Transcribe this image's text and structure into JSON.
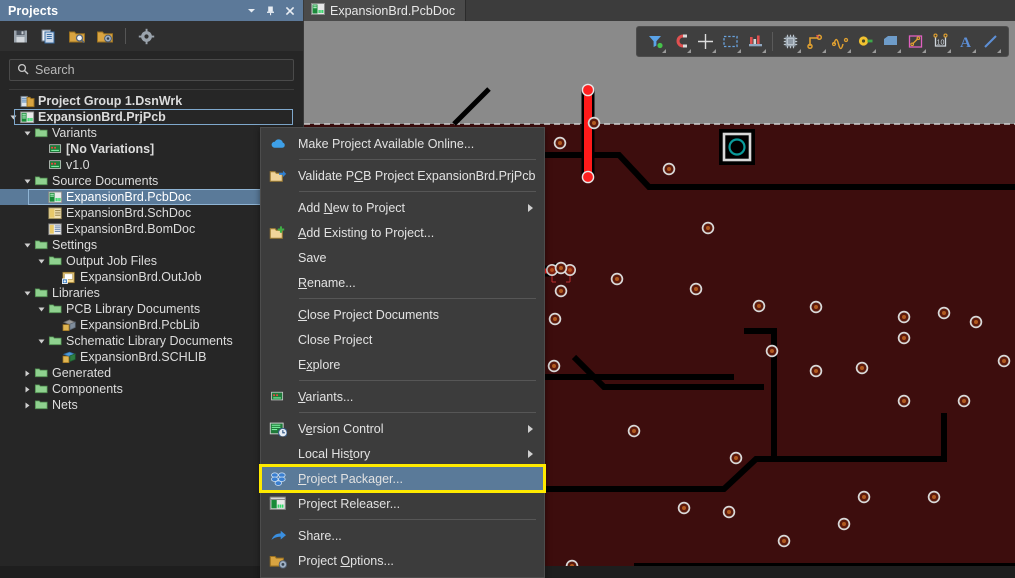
{
  "panel": {
    "title": "Projects",
    "window_buttons": [
      {
        "name": "dropdown-icon",
        "glyph": "▼"
      },
      {
        "name": "pin-icon",
        "glyph": "📌"
      },
      {
        "name": "close-icon",
        "glyph": "✕"
      }
    ],
    "toolbar": [
      {
        "name": "save-icon",
        "tip": "Save"
      },
      {
        "name": "copy-documents-icon",
        "tip": "Copy"
      },
      {
        "name": "folder-search-icon",
        "tip": "Browse"
      },
      {
        "name": "folder-settings-icon",
        "tip": "Project Settings"
      },
      {
        "name": "separator"
      },
      {
        "name": "gear-icon",
        "tip": "Options"
      }
    ],
    "search": {
      "placeholder": "Search",
      "value": ""
    },
    "tree": [
      {
        "label": "Project Group 1.DsnWrk",
        "depth": 0,
        "icon": "workspace-icon",
        "arrow": "none",
        "bold": true,
        "state": "normal"
      },
      {
        "label": "ExpansionBrd.PrjPcb",
        "depth": 0,
        "icon": "pcb-project-icon",
        "arrow": "down",
        "bold": true,
        "state": "outlined"
      },
      {
        "label": "Variants",
        "depth": 1,
        "icon": "folder-icon",
        "arrow": "down",
        "bold": false,
        "state": "normal"
      },
      {
        "label": "[No Variations]",
        "depth": 2,
        "icon": "variant-icon",
        "arrow": "none",
        "bold": true,
        "state": "normal"
      },
      {
        "label": "v1.0",
        "depth": 2,
        "icon": "variant-icon",
        "arrow": "none",
        "bold": false,
        "state": "normal"
      },
      {
        "label": "Source Documents",
        "depth": 1,
        "icon": "folder-icon",
        "arrow": "down",
        "bold": false,
        "state": "normal"
      },
      {
        "label": "ExpansionBrd.PcbDoc",
        "depth": 2,
        "icon": "pcbdoc-icon",
        "arrow": "none",
        "bold": false,
        "state": "selected"
      },
      {
        "label": "ExpansionBrd.SchDoc",
        "depth": 2,
        "icon": "schdoc-icon",
        "arrow": "none",
        "bold": false,
        "state": "normal"
      },
      {
        "label": "ExpansionBrd.BomDoc",
        "depth": 2,
        "icon": "bomdoc-icon",
        "arrow": "none",
        "bold": false,
        "state": "normal"
      },
      {
        "label": "Settings",
        "depth": 1,
        "icon": "folder-icon",
        "arrow": "down",
        "bold": false,
        "state": "normal"
      },
      {
        "label": "Output Job Files",
        "depth": 2,
        "icon": "folder-icon",
        "arrow": "down",
        "bold": false,
        "state": "normal"
      },
      {
        "label": "ExpansionBrd.OutJob",
        "depth": 3,
        "icon": "outjob-icon",
        "arrow": "none",
        "bold": false,
        "state": "normal"
      },
      {
        "label": "Libraries",
        "depth": 1,
        "icon": "folder-icon",
        "arrow": "down",
        "bold": false,
        "state": "normal"
      },
      {
        "label": "PCB Library Documents",
        "depth": 2,
        "icon": "folder-icon",
        "arrow": "down",
        "bold": false,
        "state": "normal"
      },
      {
        "label": "ExpansionBrd.PcbLib",
        "depth": 3,
        "icon": "pcblib-icon",
        "arrow": "none",
        "bold": false,
        "state": "normal"
      },
      {
        "label": "Schematic Library Documents",
        "depth": 2,
        "icon": "folder-icon",
        "arrow": "down",
        "bold": false,
        "state": "normal"
      },
      {
        "label": "ExpansionBrd.SCHLIB",
        "depth": 3,
        "icon": "schlib-icon",
        "arrow": "none",
        "bold": false,
        "state": "normal"
      },
      {
        "label": "Generated",
        "depth": 1,
        "icon": "folder-icon",
        "arrow": "right",
        "bold": false,
        "state": "normal"
      },
      {
        "label": "Components",
        "depth": 1,
        "icon": "folder-icon",
        "arrow": "right",
        "bold": false,
        "state": "normal"
      },
      {
        "label": "Nets",
        "depth": 1,
        "icon": "folder-icon",
        "arrow": "right",
        "bold": false,
        "state": "normal"
      }
    ]
  },
  "editor": {
    "tab": {
      "label": "ExpansionBrd.PcbDoc",
      "icon": "pcbdoc-icon",
      "active": true
    },
    "toolbar_icons": [
      {
        "name": "filter-icon"
      },
      {
        "name": "magnet-snap-icon"
      },
      {
        "name": "crosshair-icon"
      },
      {
        "name": "select-area-icon"
      },
      {
        "name": "place-component-icon"
      },
      {
        "name": "separator"
      },
      {
        "name": "chip-icon"
      },
      {
        "name": "route-trace-icon"
      },
      {
        "name": "differential-pair-icon"
      },
      {
        "name": "via-icon"
      },
      {
        "name": "polygon-pour-icon"
      },
      {
        "name": "room-icon"
      },
      {
        "name": "dimension-icon"
      },
      {
        "name": "text-icon"
      },
      {
        "name": "line-icon"
      }
    ]
  },
  "context_menu": {
    "items": [
      {
        "label": "Make Project Available Online...",
        "icon": "cloud-icon",
        "accel": null,
        "submenu": false,
        "highlight": false,
        "annotated": false
      },
      {
        "sep": true
      },
      {
        "label": "Validate PCB Project ExpansionBrd.PrjPcb",
        "icon": "validate-folder-icon",
        "accel": "C",
        "submenu": false,
        "highlight": false,
        "annotated": false
      },
      {
        "sep": true
      },
      {
        "label": "Add New to Project",
        "icon": null,
        "accel": "N",
        "submenu": true,
        "highlight": false,
        "annotated": false
      },
      {
        "label": "Add Existing to Project...",
        "icon": "add-existing-folder-icon",
        "accel": "A",
        "submenu": false,
        "highlight": false,
        "annotated": false
      },
      {
        "label": "Save",
        "icon": null,
        "accel": null,
        "submenu": false,
        "highlight": false,
        "annotated": false
      },
      {
        "label": "Rename...",
        "icon": null,
        "accel": "R",
        "submenu": false,
        "highlight": false,
        "annotated": false
      },
      {
        "sep": true
      },
      {
        "label": "Close Project Documents",
        "icon": null,
        "accel": "C",
        "submenu": false,
        "highlight": false,
        "annotated": false
      },
      {
        "label": "Close Project",
        "icon": null,
        "accel": null,
        "submenu": false,
        "highlight": false,
        "annotated": false
      },
      {
        "label": "Explore",
        "icon": null,
        "accel": "x",
        "submenu": false,
        "highlight": false,
        "annotated": false
      },
      {
        "sep": true
      },
      {
        "label": "Variants...",
        "icon": "variant-icon",
        "accel": "V",
        "submenu": false,
        "highlight": false,
        "annotated": false
      },
      {
        "sep": true
      },
      {
        "label": "Version Control",
        "icon": "version-control-icon",
        "accel": "e",
        "submenu": true,
        "highlight": false,
        "annotated": false
      },
      {
        "label": "Local History",
        "icon": null,
        "accel": "t",
        "submenu": true,
        "highlight": false,
        "annotated": false
      },
      {
        "label": "Project Packager...",
        "icon": "project-packager-icon",
        "accel": "P",
        "submenu": false,
        "highlight": true,
        "annotated": true
      },
      {
        "label": "Project Releaser...",
        "icon": "project-releaser-icon",
        "accel": null,
        "submenu": false,
        "highlight": false,
        "annotated": false
      },
      {
        "sep": true
      },
      {
        "label": "Share...",
        "icon": "share-arrow-icon",
        "accel": null,
        "submenu": false,
        "highlight": false,
        "annotated": false
      },
      {
        "label": "Project Options...",
        "icon": "project-options-icon",
        "accel": "O",
        "submenu": false,
        "highlight": false,
        "annotated": false
      }
    ]
  },
  "colors": {
    "panel_title_bg": "#5c7999",
    "panel_bg": "#262626",
    "selection_blue": "#5a7a99",
    "annotation_yellow": "#ffea00",
    "pcb_board": "#3d0d0d",
    "pcb_trace_red": "#ff1a1a",
    "canvas_bg": "#8a8a8a",
    "pad_ring": "#d9d9d9",
    "via_teal": "#008b8b"
  }
}
